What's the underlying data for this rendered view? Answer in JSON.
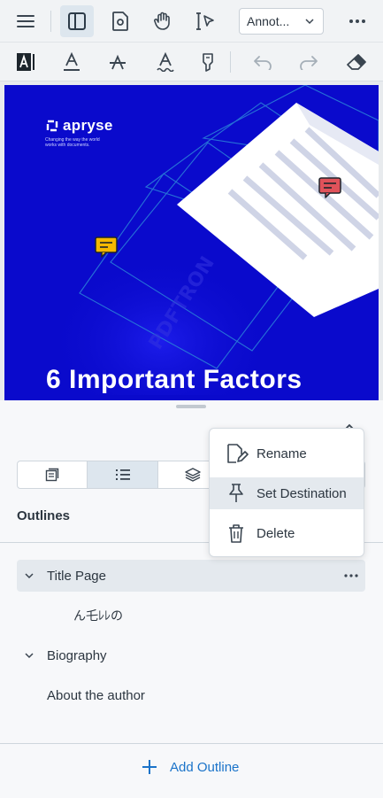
{
  "toolbar": {
    "annotation_mode": "Annot...",
    "icons": [
      "menu-icon",
      "left-panel-icon",
      "page-settings-icon",
      "pan-hand-icon",
      "select-icon",
      "more-icon"
    ]
  },
  "tool_row": {
    "icons": [
      "free-text-icon",
      "underline-icon",
      "strikeout-icon",
      "squiggly-icon",
      "text-highlight-icon",
      "undo-icon",
      "redo-icon",
      "eraser-icon"
    ]
  },
  "document": {
    "brand": "apryse",
    "tagline": "Changing the way the world works with documents.",
    "headline": "6 Important Factors"
  },
  "panel": {
    "title": "Outlines",
    "tabs": [
      "thumbnails-tab",
      "outlines-tab",
      "layers-tab"
    ],
    "items": [
      {
        "label": "Title Page",
        "expandable": true,
        "selected": true
      },
      {
        "label": "ん乇ﾚﾚの",
        "expandable": false,
        "selected": false
      },
      {
        "label": "Biography",
        "expandable": true,
        "selected": false
      },
      {
        "label": "About the author",
        "expandable": false,
        "selected": false
      }
    ],
    "add_label": "Add Outline"
  },
  "context_menu": {
    "items": [
      {
        "label": "Rename",
        "icon": "rename-icon"
      },
      {
        "label": "Set Destination",
        "icon": "pin-icon"
      },
      {
        "label": "Delete",
        "icon": "trash-icon"
      }
    ]
  },
  "colors": {
    "accent": "#1a73c9",
    "page_blue": "#0a0acc",
    "note_red": "#e0525a",
    "note_yellow": "#f5b800",
    "selected_bg": "#e4e9ee"
  }
}
